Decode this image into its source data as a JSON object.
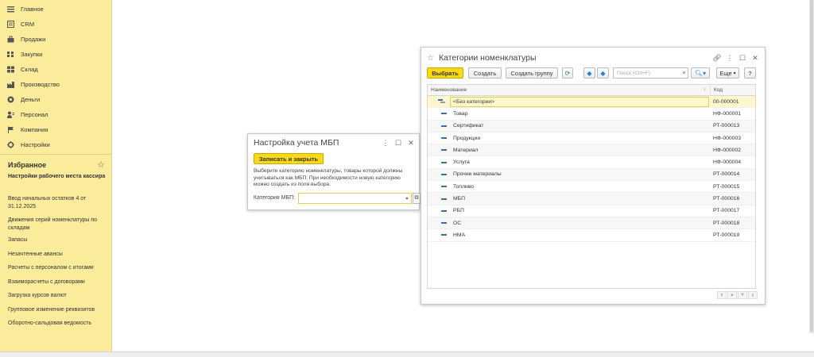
{
  "sidebar": {
    "items": [
      {
        "label": "Главное",
        "icon": "menu-icon"
      },
      {
        "label": "CRM",
        "icon": "crm-icon"
      },
      {
        "label": "Продажи",
        "icon": "sales-icon"
      },
      {
        "label": "Закупки",
        "icon": "purchases-icon"
      },
      {
        "label": "Склад",
        "icon": "warehouse-icon"
      },
      {
        "label": "Производство",
        "icon": "production-icon"
      },
      {
        "label": "Деньги",
        "icon": "money-icon"
      },
      {
        "label": "Персонал",
        "icon": "personnel-icon"
      },
      {
        "label": "Компания",
        "icon": "company-icon"
      },
      {
        "label": "Настройки",
        "icon": "settings-icon"
      }
    ],
    "favorites_title": "Избранное",
    "favorites": [
      {
        "label": "Настройки рабочего места кассира"
      },
      {
        "label": "Ввод начальных остатков 4 от 31.12.2025"
      },
      {
        "label": "Движения серий номенклатуры по складам"
      },
      {
        "label": "Запасы"
      },
      {
        "label": "Незачтенные авансы"
      },
      {
        "label": "Расчеты с персоналом с итогами"
      },
      {
        "label": "Взаиморасчеты с договорами"
      },
      {
        "label": "Загрузка курсов валют"
      },
      {
        "label": "Групповое изменение реквизитов"
      },
      {
        "label": "Оборотно-сальдовая ведомость"
      }
    ]
  },
  "mbp_window": {
    "title": "Настройка учета МБП",
    "save_close": "Записать и закрыть",
    "description": "Выберите категорию номенклатуры, товары которой должны учитываться как МБП. При необходимости новую категорию можно создать из поля выбора.",
    "field_label": "Категория МБП:",
    "field_value": ""
  },
  "category_window": {
    "title": "Категории номенклатуры",
    "toolbar": {
      "select": "Выбрать",
      "create": "Создать",
      "create_group": "Создать группу",
      "search_placeholder": "Поиск (Ctrl+F)",
      "more": "Еще",
      "help": "?"
    },
    "columns": {
      "name": "Наименование",
      "code": "Код"
    },
    "rows": [
      {
        "name": "<Без категории>",
        "code": "00-000001",
        "selected": true
      },
      {
        "name": "Товар",
        "code": "НФ-000001"
      },
      {
        "name": "Сертификат",
        "code": "РТ-000013"
      },
      {
        "name": "Продукция",
        "code": "НФ-000003"
      },
      {
        "name": "Материал",
        "code": "НФ-000002"
      },
      {
        "name": "Услуга",
        "code": "НФ-000004"
      },
      {
        "name": "Прочие материалы",
        "code": "РТ-000014"
      },
      {
        "name": "Топливо",
        "code": "РТ-000015"
      },
      {
        "name": "МБП",
        "code": "РТ-000016"
      },
      {
        "name": "РБП",
        "code": "РТ-000017"
      },
      {
        "name": "ОС",
        "code": "РТ-000018"
      },
      {
        "name": "НМА",
        "code": "РТ-000019"
      }
    ]
  },
  "colors": {
    "sidebar_bg": "#fbec9c",
    "accent_yellow": "#fbd915",
    "selection": "#fff7cf"
  }
}
